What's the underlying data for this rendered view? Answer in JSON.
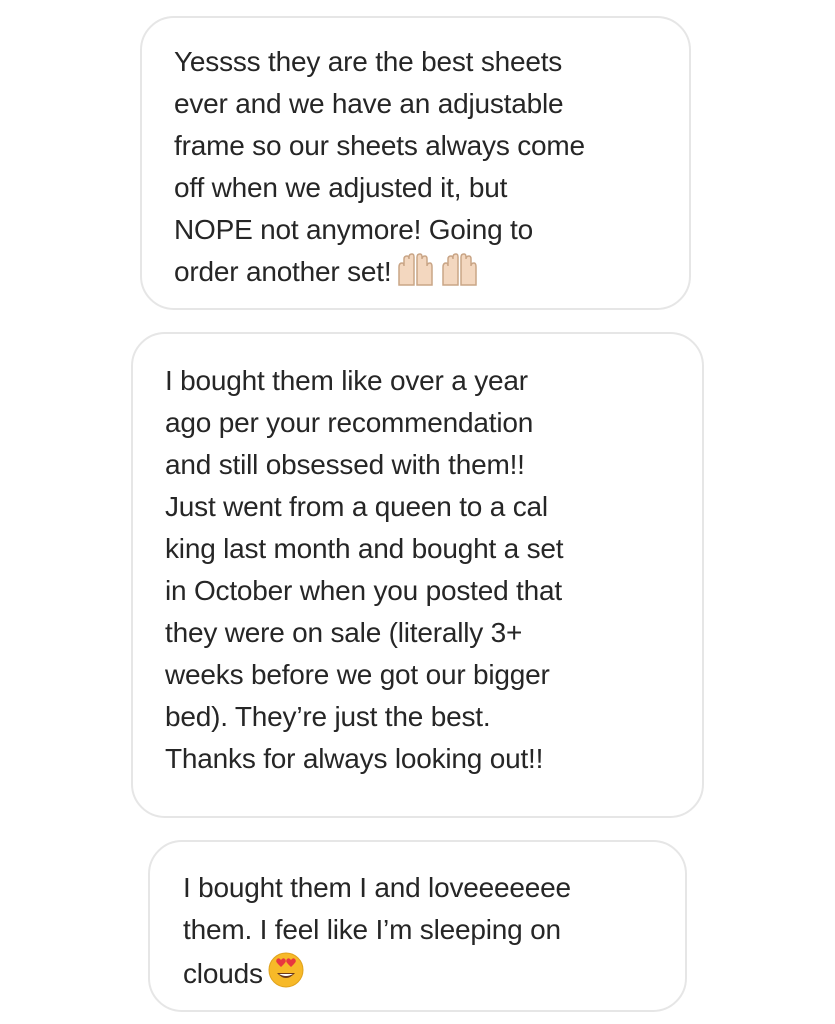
{
  "messages": [
    {
      "text": "Yessss they are the best sheets\never and we have an adjustable\nframe so our sheets always come\noff when we adjusted it, but\nNOPE not anymore! Going to\norder another set!",
      "emoji": [
        "raising-hands-icon"
      ]
    },
    {
      "text": "I bought them like over a year\nago per your recommendation\nand still obsessed with them!!\nJust went from a queen to a cal\nking last month and bought a set\nin October when you posted that\nthey were on sale (literally 3+\nweeks before we got our bigger\nbed). They’re just the best.\nThanks for always looking out!!",
      "emoji": []
    },
    {
      "text": "I bought them I and loveeeeeee\nthem. I feel like I’m sleeping on\nclouds",
      "emoji": [
        "heart-eyes-face-icon"
      ]
    }
  ],
  "colors": {
    "bubble_border": "#e6e6e6",
    "text": "#262626",
    "skin_tone": "#f3d7bf",
    "emoji_face": "#f7b928",
    "heart": "#e8373f"
  }
}
